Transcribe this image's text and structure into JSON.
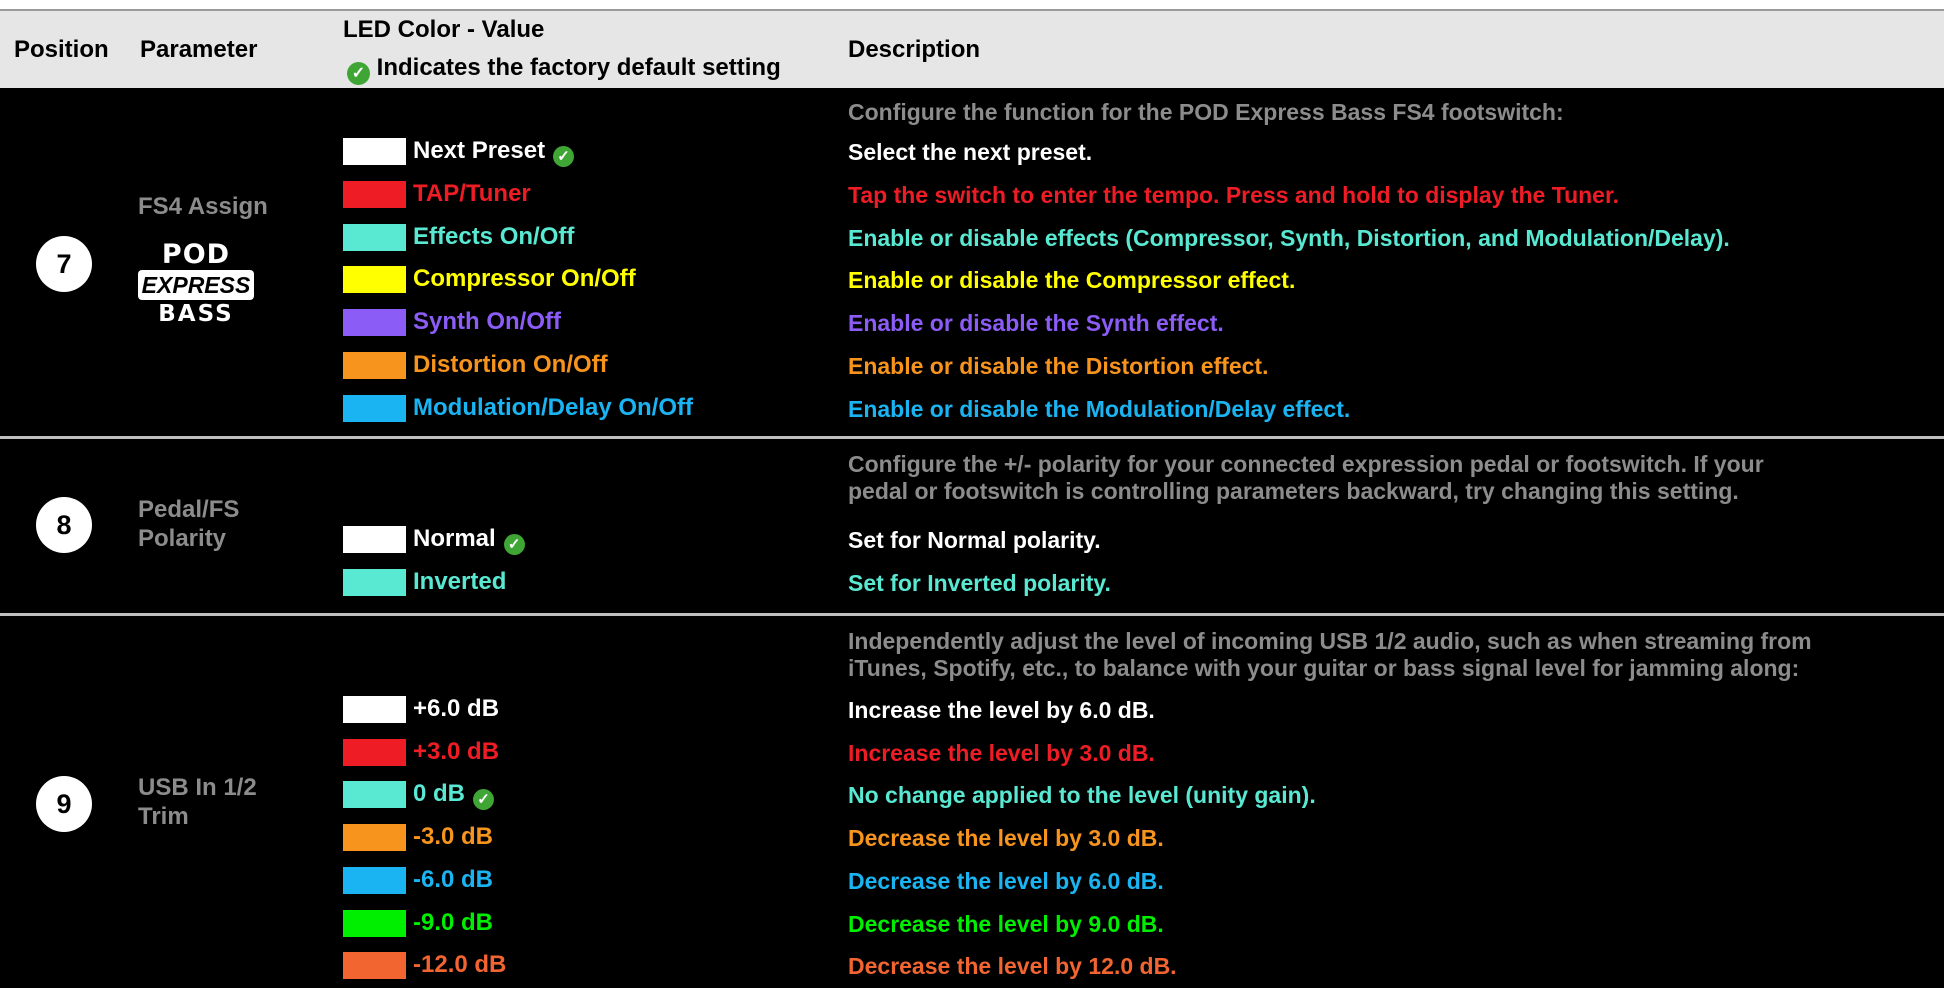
{
  "header": {
    "position": "Position",
    "parameter": "Parameter",
    "led_color_value": "LED Color - Value",
    "default_note": "Indicates the factory default setting",
    "description": "Description"
  },
  "colors": {
    "white": "#ffffff",
    "red": "#ee1c25",
    "cyan": "#59e8d2",
    "yellow": "#ffff00",
    "purple": "#8b5cf6",
    "orange": "#f7941d",
    "blue": "#1ab4f2",
    "green": "#00ee00",
    "dark_orange": "#f26531",
    "check_green": "#3fa535"
  },
  "icons": {
    "default_check": "check-circle-icon"
  },
  "sections": [
    {
      "position": "7",
      "parameter": "FS4 Assign",
      "logo": {
        "line1": "POD",
        "line2": "EXPRESS",
        "line3": "BASS"
      },
      "intro": "Configure the function for the POD Express Bass FS4 footswitch:",
      "options": [
        {
          "color": "white",
          "label": "Next Preset",
          "default": true,
          "description": "Select the next preset."
        },
        {
          "color": "red",
          "label": "TAP/Tuner",
          "default": false,
          "description": "Tap the switch to enter the tempo. Press and hold to display the Tuner."
        },
        {
          "color": "cyan",
          "label": "Effects On/Off",
          "default": false,
          "description": "Enable or disable effects (Compressor, Synth, Distortion, and Modulation/Delay)."
        },
        {
          "color": "yellow",
          "label": "Compressor On/Off",
          "default": false,
          "description": "Enable or disable the Compressor effect."
        },
        {
          "color": "purple",
          "label": "Synth On/Off",
          "default": false,
          "description": "Enable or disable the Synth effect."
        },
        {
          "color": "orange",
          "label": "Distortion On/Off",
          "default": false,
          "description": "Enable or disable the Distortion effect."
        },
        {
          "color": "blue",
          "label": "Modulation/Delay On/Off",
          "default": false,
          "description": "Enable or disable the Modulation/Delay effect."
        }
      ]
    },
    {
      "position": "8",
      "parameter_line1": "Pedal/FS",
      "parameter_line2": "Polarity",
      "intro_line1": "Configure the +/- polarity for your connected expression pedal or footswitch. If your",
      "intro_line2": "pedal or footswitch is controlling parameters backward, try changing this setting.",
      "options": [
        {
          "color": "white",
          "label": "Normal",
          "default": true,
          "description": "Set for Normal polarity."
        },
        {
          "color": "cyan",
          "label": "Inverted",
          "default": false,
          "description": "Set for Inverted polarity."
        }
      ]
    },
    {
      "position": "9",
      "parameter_line1": "USB In 1/2",
      "parameter_line2": "Trim",
      "intro_line1": "Independently adjust the level of incoming USB 1/2 audio, such as when streaming from",
      "intro_line2": "iTunes, Spotify, etc., to balance with your guitar or bass signal level for jamming along:",
      "options": [
        {
          "color": "white",
          "label": "+6.0 dB",
          "default": false,
          "description": "Increase the level by 6.0 dB."
        },
        {
          "color": "red",
          "label": "+3.0 dB",
          "default": false,
          "description": "Increase the level by 3.0 dB."
        },
        {
          "color": "cyan",
          "label": "0 dB",
          "default": true,
          "description": "No change applied to the level (unity gain)."
        },
        {
          "color": "orange",
          "label": "-3.0 dB",
          "default": false,
          "description": "Decrease the level by 3.0 dB."
        },
        {
          "color": "blue",
          "label": "-6.0 dB",
          "default": false,
          "description": "Decrease the level by 6.0 dB."
        },
        {
          "color": "green",
          "label": "-9.0 dB",
          "default": false,
          "description": "Decrease the level by 9.0 dB."
        },
        {
          "color": "dark_orange",
          "label": "-12.0 dB",
          "default": false,
          "description": "Decrease the level by 12.0 dB."
        }
      ]
    }
  ]
}
